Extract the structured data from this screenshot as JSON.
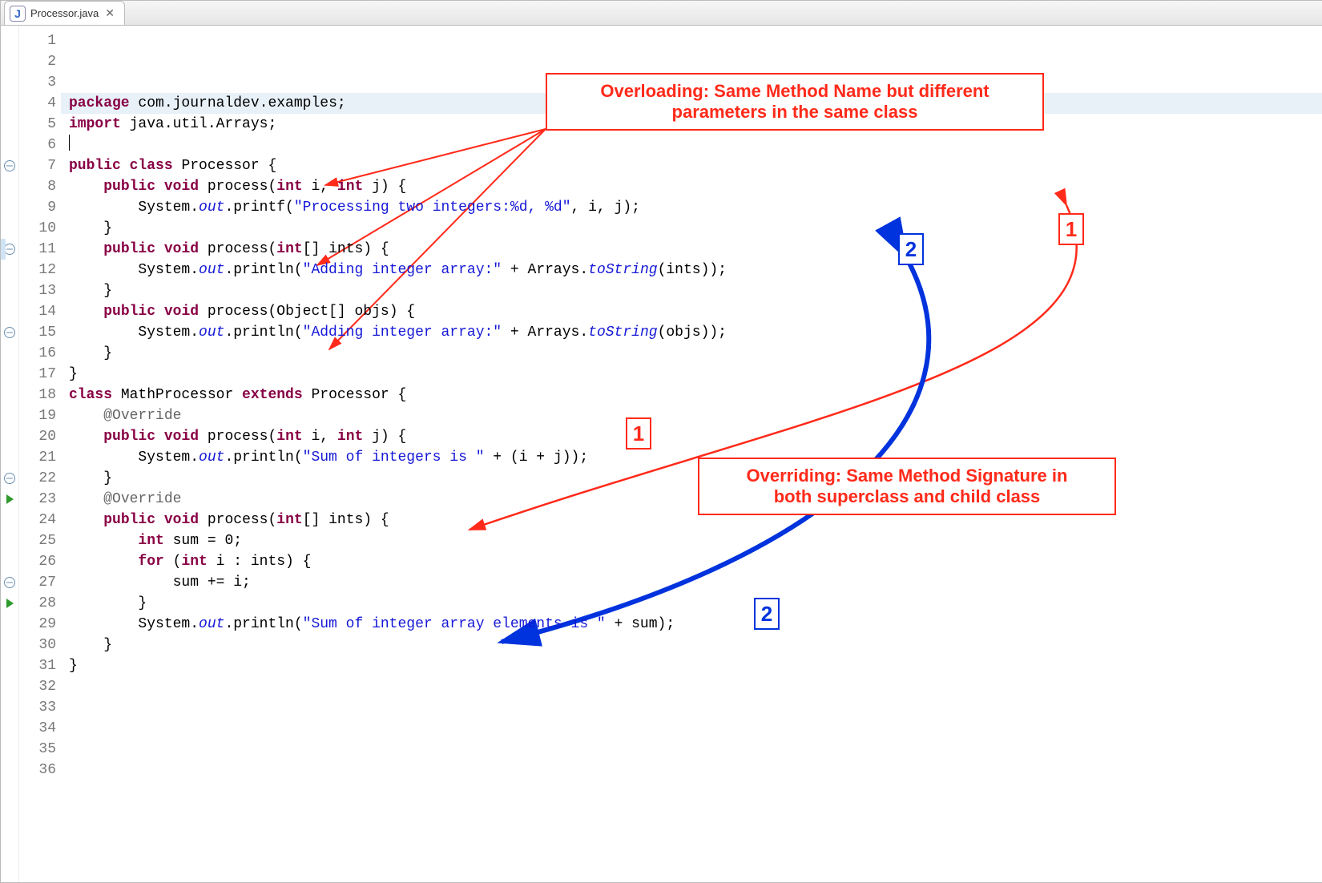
{
  "tab": {
    "icon_letter": "J",
    "filename": "Processor.java",
    "close_glyph": "✕"
  },
  "highlight_line": 4,
  "gutter": {
    "folds_at": [
      7,
      11,
      15,
      22,
      27
    ],
    "override_markers_at": [
      23,
      28
    ],
    "bluebar_start": 11
  },
  "callouts": {
    "overloading": "Overloading: Same Method Name but different\nparameters in the same class",
    "overriding": "Overriding: Same Method Signature in\nboth superclass and child class",
    "n1": "1",
    "n2": "2"
  },
  "code_lines": [
    {
      "tokens": [
        [
          "kw",
          "package"
        ],
        [
          "",
          " com.journaldev.examples;"
        ]
      ]
    },
    {
      "tokens": [
        [
          "",
          ""
        ]
      ]
    },
    {
      "tokens": [
        [
          "kw",
          "import"
        ],
        [
          "",
          " java.util.Arrays;"
        ]
      ]
    },
    {
      "tokens": [
        [
          "",
          "  "
        ]
      ],
      "cursor": true,
      "cursor_before": true
    },
    {
      "tokens": [
        [
          "kw",
          "public"
        ],
        [
          "",
          " "
        ],
        [
          "kw",
          "class"
        ],
        [
          "",
          " Processor {"
        ]
      ]
    },
    {
      "tokens": [
        [
          "",
          ""
        ]
      ]
    },
    {
      "tokens": [
        [
          "",
          "    "
        ],
        [
          "kw",
          "public"
        ],
        [
          "",
          " "
        ],
        [
          "kw",
          "void"
        ],
        [
          "",
          " process("
        ],
        [
          "kw",
          "int"
        ],
        [
          "",
          " i, "
        ],
        [
          "kw",
          "int"
        ],
        [
          "",
          " j) {"
        ]
      ]
    },
    {
      "tokens": [
        [
          "",
          "        System."
        ],
        [
          "static",
          "out"
        ],
        [
          "",
          ".printf("
        ],
        [
          "str",
          "\"Processing two integers:%d, %d\""
        ],
        [
          "",
          ", i, j);"
        ]
      ]
    },
    {
      "tokens": [
        [
          "",
          "    }"
        ]
      ]
    },
    {
      "tokens": [
        [
          "",
          ""
        ]
      ]
    },
    {
      "tokens": [
        [
          "",
          "    "
        ],
        [
          "kw",
          "public"
        ],
        [
          "",
          " "
        ],
        [
          "kw",
          "void"
        ],
        [
          "",
          " process("
        ],
        [
          "kw",
          "int"
        ],
        [
          "",
          "[] ints) {"
        ]
      ]
    },
    {
      "tokens": [
        [
          "",
          "        System."
        ],
        [
          "static",
          "out"
        ],
        [
          "",
          ".println("
        ],
        [
          "str",
          "\"Adding integer array:\""
        ],
        [
          "",
          " + Arrays."
        ],
        [
          "static",
          "toString"
        ],
        [
          "",
          "(ints));"
        ]
      ]
    },
    {
      "tokens": [
        [
          "",
          "    }"
        ]
      ]
    },
    {
      "tokens": [
        [
          "",
          ""
        ]
      ]
    },
    {
      "tokens": [
        [
          "",
          "    "
        ],
        [
          "kw",
          "public"
        ],
        [
          "",
          " "
        ],
        [
          "kw",
          "void"
        ],
        [
          "",
          " process(Object[] objs) {"
        ]
      ]
    },
    {
      "tokens": [
        [
          "",
          "        System."
        ],
        [
          "static",
          "out"
        ],
        [
          "",
          ".println("
        ],
        [
          "str",
          "\"Adding integer array:\""
        ],
        [
          "",
          " + Arrays."
        ],
        [
          "static",
          "toString"
        ],
        [
          "",
          "(objs));"
        ]
      ]
    },
    {
      "tokens": [
        [
          "",
          "    }"
        ]
      ]
    },
    {
      "tokens": [
        [
          "",
          "}"
        ]
      ]
    },
    {
      "tokens": [
        [
          "",
          ""
        ]
      ]
    },
    {
      "tokens": [
        [
          "kw",
          "class"
        ],
        [
          "",
          " MathProcessor "
        ],
        [
          "kw",
          "extends"
        ],
        [
          "",
          " Processor {"
        ]
      ]
    },
    {
      "tokens": [
        [
          "",
          ""
        ]
      ]
    },
    {
      "tokens": [
        [
          "",
          "    "
        ],
        [
          "anno",
          "@Override"
        ]
      ]
    },
    {
      "tokens": [
        [
          "",
          "    "
        ],
        [
          "kw",
          "public"
        ],
        [
          "",
          " "
        ],
        [
          "kw",
          "void"
        ],
        [
          "",
          " process("
        ],
        [
          "kw",
          "int"
        ],
        [
          "",
          " i, "
        ],
        [
          "kw",
          "int"
        ],
        [
          "",
          " j) {"
        ]
      ]
    },
    {
      "tokens": [
        [
          "",
          "        System."
        ],
        [
          "static",
          "out"
        ],
        [
          "",
          ".println("
        ],
        [
          "str",
          "\"Sum of integers is \""
        ],
        [
          "",
          " + (i + j));"
        ]
      ]
    },
    {
      "tokens": [
        [
          "",
          "    }"
        ]
      ]
    },
    {
      "tokens": [
        [
          "",
          ""
        ]
      ]
    },
    {
      "tokens": [
        [
          "",
          "    "
        ],
        [
          "anno",
          "@Override"
        ]
      ]
    },
    {
      "tokens": [
        [
          "",
          "    "
        ],
        [
          "kw",
          "public"
        ],
        [
          "",
          " "
        ],
        [
          "kw",
          "void"
        ],
        [
          "",
          " process("
        ],
        [
          "kw",
          "int"
        ],
        [
          "",
          "[] ints) {"
        ]
      ]
    },
    {
      "tokens": [
        [
          "",
          "        "
        ],
        [
          "kw",
          "int"
        ],
        [
          "",
          " sum = 0;"
        ]
      ]
    },
    {
      "tokens": [
        [
          "",
          "        "
        ],
        [
          "kw",
          "for"
        ],
        [
          "",
          " ("
        ],
        [
          "kw",
          "int"
        ],
        [
          "",
          " i : ints) {"
        ]
      ]
    },
    {
      "tokens": [
        [
          "",
          "            sum += i;"
        ]
      ]
    },
    {
      "tokens": [
        [
          "",
          "        }"
        ]
      ]
    },
    {
      "tokens": [
        [
          "",
          "        System."
        ],
        [
          "static",
          "out"
        ],
        [
          "",
          ".println("
        ],
        [
          "str",
          "\"Sum of integer array elements is \""
        ],
        [
          "",
          " + sum);"
        ]
      ]
    },
    {
      "tokens": [
        [
          "",
          "    }"
        ]
      ]
    },
    {
      "tokens": [
        [
          "",
          ""
        ]
      ]
    },
    {
      "tokens": [
        [
          "",
          "}"
        ]
      ]
    }
  ]
}
